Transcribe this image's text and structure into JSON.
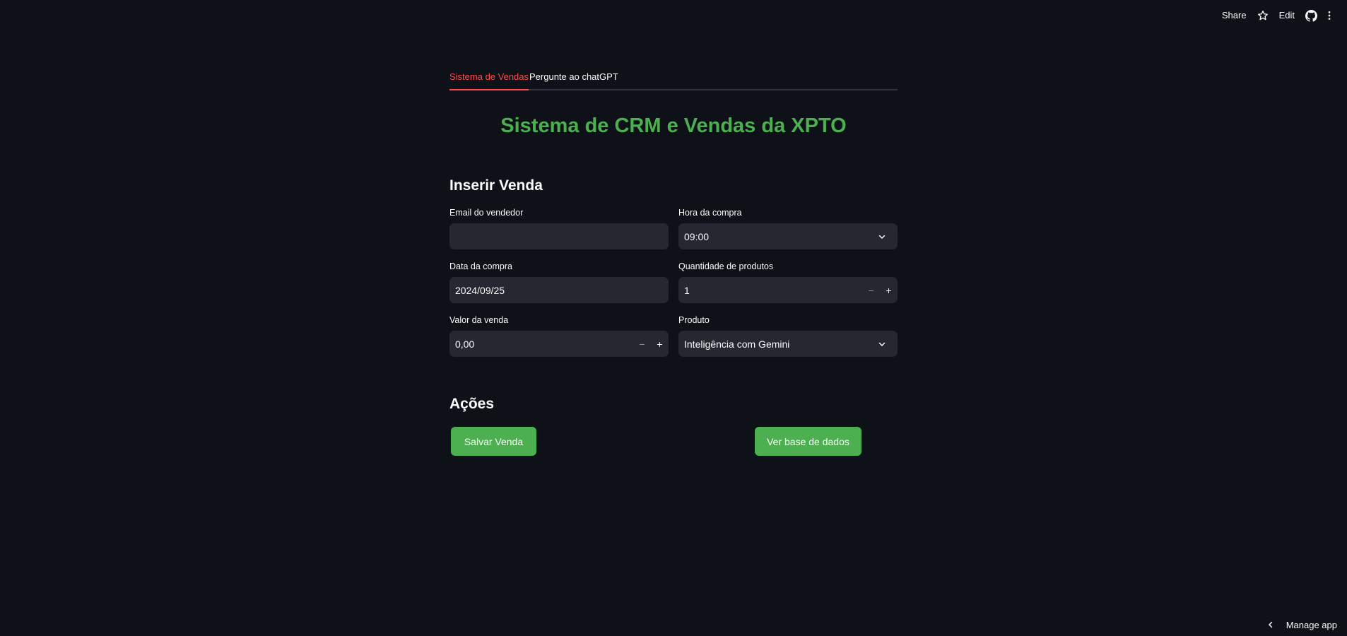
{
  "toolbar": {
    "share_label": "Share",
    "edit_label": "Edit",
    "icons": [
      "star-icon",
      "github-icon",
      "more-vertical-icon"
    ]
  },
  "tabs": [
    {
      "label": "Sistema de Vendas",
      "active": true
    },
    {
      "label": "Pergunte ao chatGPT",
      "active": false
    }
  ],
  "page": {
    "title": "Sistema de CRM e Vendas da XPTO",
    "title_color": "#4caf50"
  },
  "form": {
    "section_title": "Inserir Venda",
    "email": {
      "label": "Email do vendedor",
      "value": "",
      "placeholder": ""
    },
    "hora": {
      "label": "Hora da compra",
      "value": "09:00"
    },
    "data": {
      "label": "Data da compra",
      "value": "2024/09/25"
    },
    "quantidade": {
      "label": "Quantidade de produtos",
      "value": "1",
      "minus": "−",
      "plus": "+"
    },
    "valor": {
      "label": "Valor da venda",
      "value": "0,00",
      "minus": "−",
      "plus": "+"
    },
    "produto": {
      "label": "Produto",
      "value": "Inteligência com Gemini"
    }
  },
  "actions": {
    "section_title": "Ações",
    "save_label": "Salvar Venda",
    "view_db_label": "Ver base de dados"
  },
  "footer": {
    "manage_app_label": "Manage app"
  },
  "colors": {
    "background": "#0e1117",
    "input_bg": "#262730",
    "accent_red": "#ff4b4b",
    "button_green": "#4caf50"
  }
}
